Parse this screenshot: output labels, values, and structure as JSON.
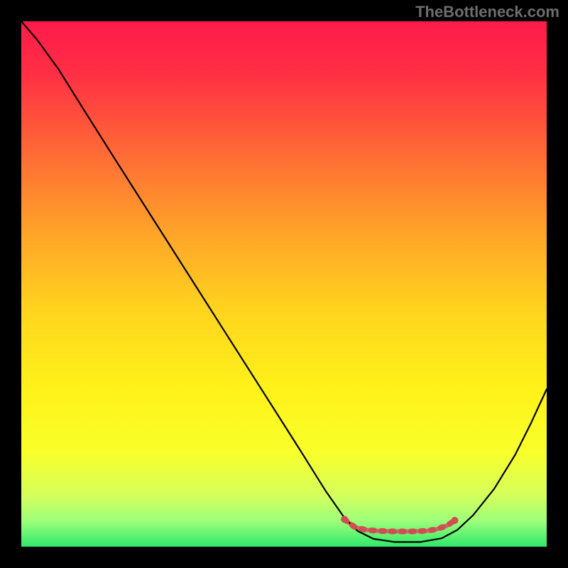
{
  "watermark": "TheBottleneck.com",
  "chart_data": {
    "type": "line",
    "title": "",
    "xlabel": "",
    "ylabel": "",
    "xlim": [
      0,
      100
    ],
    "ylim": [
      0,
      100
    ],
    "background_gradient": {
      "stops": [
        {
          "offset": 0.0,
          "color": "#ff1a4b"
        },
        {
          "offset": 0.1,
          "color": "#ff2f44"
        },
        {
          "offset": 0.25,
          "color": "#ff6a36"
        },
        {
          "offset": 0.4,
          "color": "#ffa329"
        },
        {
          "offset": 0.55,
          "color": "#ffd41e"
        },
        {
          "offset": 0.7,
          "color": "#fff21a"
        },
        {
          "offset": 0.82,
          "color": "#f9ff2a"
        },
        {
          "offset": 0.9,
          "color": "#d6ff5a"
        },
        {
          "offset": 0.95,
          "color": "#9fff7a"
        },
        {
          "offset": 1.0,
          "color": "#30e86b"
        }
      ]
    },
    "series": [
      {
        "name": "black-curve",
        "color": "#000000",
        "width": 2.2,
        "points": [
          {
            "x": 0.0,
            "y": 100.0
          },
          {
            "x": 3.0,
            "y": 96.5
          },
          {
            "x": 7.0,
            "y": 91.0
          },
          {
            "x": 12.0,
            "y": 83.0
          },
          {
            "x": 18.0,
            "y": 73.5
          },
          {
            "x": 25.0,
            "y": 62.5
          },
          {
            "x": 32.0,
            "y": 51.5
          },
          {
            "x": 39.0,
            "y": 40.5
          },
          {
            "x": 46.0,
            "y": 29.5
          },
          {
            "x": 53.0,
            "y": 18.5
          },
          {
            "x": 58.0,
            "y": 10.5
          },
          {
            "x": 61.5,
            "y": 5.5
          },
          {
            "x": 64.0,
            "y": 3.0
          },
          {
            "x": 67.0,
            "y": 1.5
          },
          {
            "x": 71.0,
            "y": 0.9
          },
          {
            "x": 76.0,
            "y": 0.9
          },
          {
            "x": 80.0,
            "y": 1.6
          },
          {
            "x": 83.0,
            "y": 3.2
          },
          {
            "x": 86.0,
            "y": 6.0
          },
          {
            "x": 90.0,
            "y": 11.0
          },
          {
            "x": 94.0,
            "y": 17.5
          },
          {
            "x": 97.0,
            "y": 23.5
          },
          {
            "x": 100.0,
            "y": 30.0
          }
        ]
      },
      {
        "name": "red-line-front",
        "color": "#d14e4e",
        "width": 8,
        "points": [
          {
            "x": 61.5,
            "y": 5.2
          },
          {
            "x": 63.5,
            "y": 3.7
          },
          {
            "x": 65.5,
            "y": 3.2
          },
          {
            "x": 68.0,
            "y": 3.0
          },
          {
            "x": 71.0,
            "y": 2.9
          },
          {
            "x": 74.0,
            "y": 2.9
          },
          {
            "x": 77.0,
            "y": 3.0
          },
          {
            "x": 79.0,
            "y": 3.3
          },
          {
            "x": 81.0,
            "y": 4.0
          },
          {
            "x": 82.5,
            "y": 5.0
          }
        ]
      },
      {
        "name": "red-line-back",
        "color": "#c47070",
        "width": 6,
        "points": [
          {
            "x": 61.5,
            "y": 5.2
          },
          {
            "x": 63.5,
            "y": 3.7
          },
          {
            "x": 65.5,
            "y": 3.2
          },
          {
            "x": 68.0,
            "y": 3.0
          },
          {
            "x": 71.0,
            "y": 2.9
          },
          {
            "x": 74.0,
            "y": 2.9
          },
          {
            "x": 77.0,
            "y": 3.0
          },
          {
            "x": 79.0,
            "y": 3.3
          },
          {
            "x": 81.0,
            "y": 4.0
          },
          {
            "x": 82.5,
            "y": 5.0
          }
        ]
      }
    ]
  }
}
